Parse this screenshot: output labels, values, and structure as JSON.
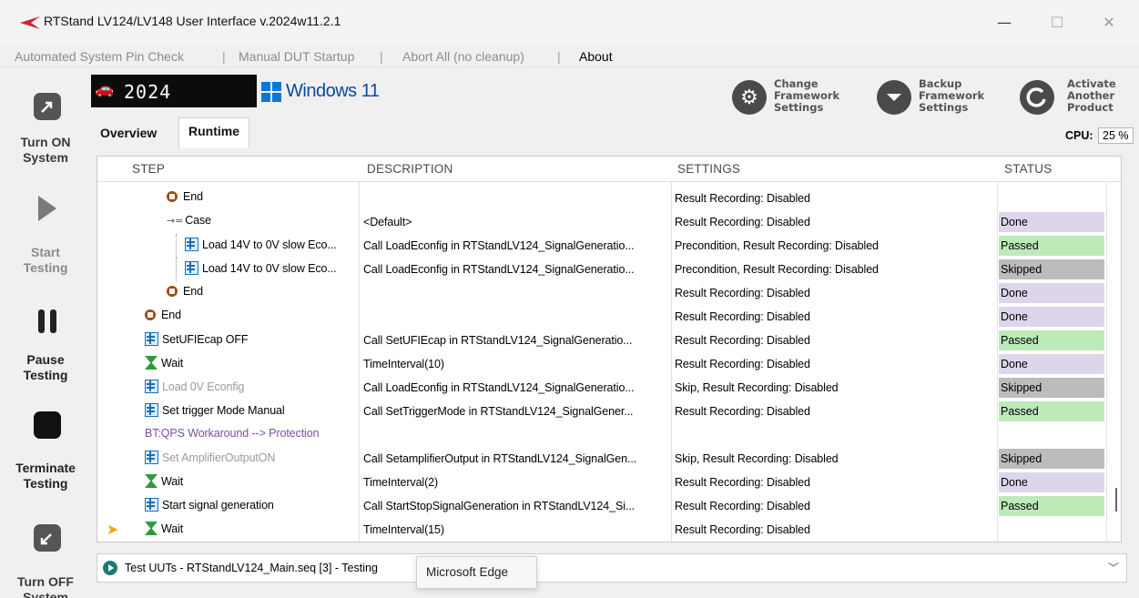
{
  "window": {
    "title": "RTStand LV124/LV148 User Interface v.2024w11.2.1",
    "min": "—",
    "max": "☐",
    "close": "✕"
  },
  "menu": {
    "items": [
      "Automated System Pin Check",
      "Manual DUT Startup",
      "Abort All (no cleanup)",
      "About"
    ],
    "separator": "|"
  },
  "sidebar": {
    "turn_on": "Turn ON\nSystem",
    "start": "Start\nTesting",
    "pause": "Pause\nTesting",
    "terminate": "Terminate\nTesting",
    "turn_off": "Turn OFF\nSystem"
  },
  "header": {
    "brand_year": "2024",
    "windows_label": "Windows 11",
    "buttons": [
      {
        "label": "Change\nFramework\nSettings",
        "icon": "gear-icon"
      },
      {
        "label": "Backup\nFramework\nSettings",
        "icon": "chevron-down-icon"
      },
      {
        "label": "Activate\nAnother\nProduct",
        "icon": "refresh-icon"
      }
    ]
  },
  "tabs": [
    "Overview",
    "Runtime"
  ],
  "cpu": {
    "label": "CPU:",
    "value": "25 %"
  },
  "grid": {
    "columns": [
      "STEP",
      "DESCRIPTION",
      "SETTINGS",
      "STATUS"
    ],
    "rows": [
      {
        "step": "End",
        "icon": "end",
        "indent": 2,
        "description": "",
        "settings": "Result Recording: Disabled",
        "status": ""
      },
      {
        "step": "Case",
        "icon": "case",
        "indent": 2,
        "description": "<Default>",
        "settings": "Result Recording: Disabled",
        "status": "Done"
      },
      {
        "step": "Load 14V to 0V slow Eco...",
        "icon": "step",
        "indent": 3,
        "description": "Call LoadEconfig in RTStandLV124_SignalGeneratio...",
        "settings": "Precondition, Result Recording: Disabled",
        "status": "Passed"
      },
      {
        "step": "Load 14V to 0V slow Eco...",
        "icon": "step",
        "indent": 3,
        "description": "Call LoadEconfig in RTStandLV124_SignalGeneratio...",
        "settings": "Precondition, Result Recording: Disabled",
        "status": "Skipped"
      },
      {
        "step": "End",
        "icon": "end",
        "indent": 2,
        "description": "",
        "settings": "Result Recording: Disabled",
        "status": "Done"
      },
      {
        "step": "End",
        "icon": "end",
        "indent": 1,
        "description": "",
        "settings": "Result Recording: Disabled",
        "status": "Done"
      },
      {
        "step": "SetUFIEcap OFF",
        "icon": "step",
        "indent": 1,
        "description": "Call SetUFIEcap in RTStandLV124_SignalGeneratio...",
        "settings": "Result Recording: Disabled",
        "status": "Passed"
      },
      {
        "step": "Wait",
        "icon": "wait",
        "indent": 1,
        "description": "TimeInterval(10)",
        "settings": "Result Recording: Disabled",
        "status": "Done"
      },
      {
        "step": "Load 0V Econfig",
        "icon": "step",
        "indent": 1,
        "dim": true,
        "description": "Call LoadEconfig in RTStandLV124_SignalGeneratio...",
        "settings": "Skip, Result Recording: Disabled",
        "status": "Skipped"
      },
      {
        "step": "Set trigger Mode Manual",
        "icon": "step",
        "indent": 1,
        "description": "Call SetTriggerMode in RTStandLV124_SignalGener...",
        "settings": "Result Recording: Disabled",
        "status": "Passed"
      },
      {
        "step": "BT:QPS Workaround --> Protection",
        "icon": "none",
        "indent": 1,
        "purple": true,
        "description": "",
        "settings": "",
        "status": ""
      },
      {
        "step": "Set AmplifierOutputON",
        "icon": "step",
        "indent": 1,
        "dim": true,
        "description": "Call SetamplifierOutput in RTStandLV124_SignalGen...",
        "settings": "Skip, Result Recording: Disabled",
        "status": "Skipped"
      },
      {
        "step": "Wait",
        "icon": "wait",
        "indent": 1,
        "description": "TimeInterval(2)",
        "settings": "Result Recording: Disabled",
        "status": "Done"
      },
      {
        "step": "Start signal generation",
        "icon": "step",
        "indent": 1,
        "description": "Call StartStopSignalGeneration in RTStandLV124_Si...",
        "settings": "Result Recording: Disabled",
        "status": "Passed"
      },
      {
        "step": "Wait",
        "icon": "wait",
        "indent": 1,
        "current": true,
        "description": "TimeInterval(15)",
        "settings": "Result Recording: Disabled",
        "status": ""
      }
    ]
  },
  "bottom": {
    "text": "Test UUTs - RTStandLV124_Main.seq [3] - Testing",
    "tooltip": "Microsoft Edge",
    "chevron": "﹀"
  },
  "colors": {
    "done": "#ddd6eb",
    "passed": "#bdeab9",
    "skipped": "#bcbcbc",
    "accent": "#0a78d4"
  }
}
